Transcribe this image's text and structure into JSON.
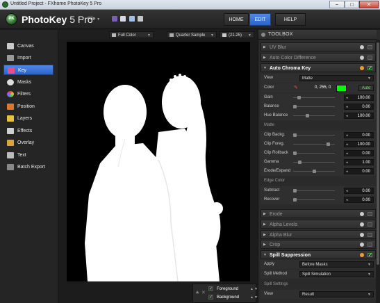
{
  "window": {
    "title": "Untitled Project - FXhome PhotoKey 5 Pro",
    "controls": [
      "−",
      "□",
      "✕"
    ]
  },
  "header": {
    "logo_badge": "PK",
    "logo_name": "PhotoKey",
    "logo_version": " 5 Pro",
    "file_menu": "File",
    "nav": [
      "HOME",
      "EDIT",
      "HELP"
    ],
    "active_nav": "EDIT"
  },
  "sidebar": {
    "items": [
      {
        "label": "Canvas",
        "icon": "canvas-icon",
        "color": "#c9c9c9"
      },
      {
        "label": "Import",
        "icon": "import-icon",
        "color": "#9a9a9a"
      },
      {
        "label": "Key",
        "icon": "key-icon",
        "color": "#e64d8c"
      },
      {
        "label": "Masks",
        "icon": "masks-icon",
        "color": "#dddddd"
      },
      {
        "label": "Filters",
        "icon": "filters-icon",
        "color": "#e8b43a"
      },
      {
        "label": "Position",
        "icon": "position-icon",
        "color": "#e0762e"
      },
      {
        "label": "Layers",
        "icon": "layers-icon",
        "color": "#e8c13a"
      },
      {
        "label": "Effects",
        "icon": "effects-icon",
        "color": "#cfcfcf"
      },
      {
        "label": "Overlay",
        "icon": "overlay-icon",
        "color": "#d9a53a"
      },
      {
        "label": "Text",
        "icon": "text-icon",
        "color": "#bbbbbb"
      },
      {
        "label": "Batch Export",
        "icon": "batch-export-icon",
        "color": "#888888"
      }
    ],
    "active": "Key"
  },
  "viewbar": {
    "display_mode": "Full Color",
    "quality": "Quarter Sample",
    "zoom": "(21.25)"
  },
  "layers_bar": {
    "rows": [
      "Foreground",
      "Background"
    ]
  },
  "toolbox": {
    "title": "TOOLBOX",
    "collapsed_top": [
      {
        "label": "UV Blur"
      },
      {
        "label": "Auto Color Difference"
      }
    ],
    "chroma_key": {
      "label": "Auto Chroma Key",
      "view_label": "View",
      "view_value": "Matte",
      "color_label": "Color",
      "color_rgb": "0, 255, 0",
      "color_hex": "#00ff00",
      "auto_label": "Auto",
      "params": [
        {
          "label": "Gain",
          "value": "100.00",
          "level": 0.1
        },
        {
          "label": "Balance",
          "value": "0.00",
          "level": 0.0
        },
        {
          "label": "Hue Balance",
          "value": "100.00",
          "level": 0.3
        }
      ],
      "matte_section": "Matte",
      "matte_params": [
        {
          "label": "Clip Backg.",
          "value": "0.00",
          "level": 0.0
        },
        {
          "label": "Clip Foreg.",
          "value": "100.00",
          "level": 0.8
        },
        {
          "label": "Clip Rollback",
          "value": "0.00",
          "level": 0.0
        },
        {
          "label": "Gamma",
          "value": "1.00",
          "level": 0.12
        },
        {
          "label": "Erode/Expand",
          "value": "0.00",
          "level": 0.5
        }
      ],
      "edge_section": "Edge Color",
      "edge_params": [
        {
          "label": "Subtract",
          "value": "0.00",
          "level": 0.0
        },
        {
          "label": "Recover",
          "value": "0.00",
          "level": 0.0
        }
      ]
    },
    "collapsed_mid": [
      {
        "label": "Erode"
      },
      {
        "label": "Alpha Levels"
      },
      {
        "label": "Alpha Blur"
      },
      {
        "label": "Crop"
      }
    ],
    "spill": {
      "label": "Spill Suppression",
      "apply_label": "Apply",
      "apply_value": "Before Masks",
      "method_label": "Spill Method",
      "method_value": "Spill Simulation",
      "settings_section": "Spill Settings",
      "view_label": "View",
      "view_value": "Result"
    }
  }
}
